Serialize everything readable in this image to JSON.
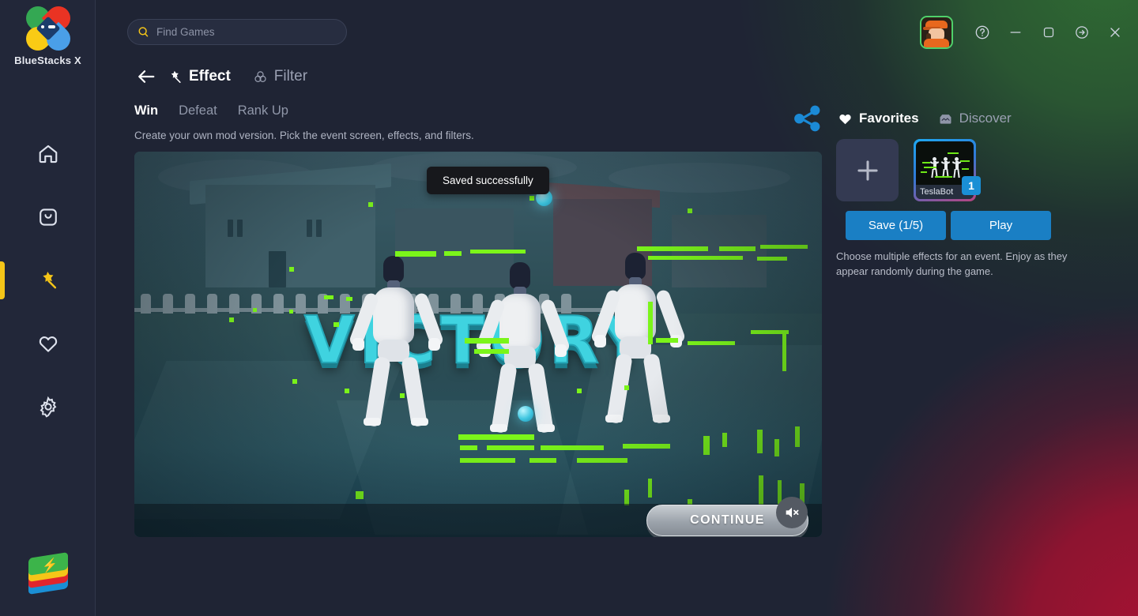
{
  "app": {
    "brand_name": "BlueStacks X",
    "logo_icon": "bluestacks-logo-icon",
    "taskbar_icon": "bluestacks-stack-icon"
  },
  "search": {
    "placeholder": "Find Games",
    "value": "",
    "icon": "search-icon"
  },
  "window_controls": [
    {
      "name": "help-button",
      "icon": "question-circle-icon"
    },
    {
      "name": "minimize-button",
      "icon": "minimize-icon"
    },
    {
      "name": "maximize-button",
      "icon": "maximize-square-icon"
    },
    {
      "name": "exit-button",
      "icon": "arrow-right-circle-icon"
    },
    {
      "name": "close-button",
      "icon": "close-x-icon"
    }
  ],
  "avatar": {
    "name": "user-avatar",
    "icon": "avatar-icon",
    "border_color": "#4fd06a"
  },
  "sidebar": {
    "items": [
      {
        "label": "Home",
        "icon": "home-icon",
        "active": false
      },
      {
        "label": "Store",
        "icon": "bag-icon",
        "active": false
      },
      {
        "label": "Effects",
        "icon": "magic-wand-icon",
        "active": true
      },
      {
        "label": "Favorites",
        "icon": "heart-icon",
        "active": false
      },
      {
        "label": "Settings",
        "icon": "gear-icon",
        "active": false
      }
    ],
    "active_indicator_color": "#f5c518"
  },
  "header": {
    "back_icon": "back-arrow-icon",
    "modes": [
      {
        "label": "Effect",
        "icon": "magic-wand-icon",
        "active": true
      },
      {
        "label": "Filter",
        "icon": "venn-circles-icon",
        "active": false
      }
    ]
  },
  "tabs": [
    {
      "label": "Win",
      "active": true
    },
    {
      "label": "Defeat",
      "active": false
    },
    {
      "label": "Rank Up",
      "active": false
    }
  ],
  "subtitle": "Create your own mod version. Pick the event screen, effects, and filters.",
  "preview": {
    "victory_text": "VICTORY",
    "continue_label": "CONTINUE",
    "mute_icon": "speaker-mute-icon",
    "toast": "Saved successfully"
  },
  "right_panel": {
    "share_icon": "share-icon",
    "segments": [
      {
        "label": "Favorites",
        "icon": "heart-filled-icon",
        "active": true
      },
      {
        "label": "Discover",
        "icon": "store-icon",
        "active": false
      }
    ],
    "add_card": {
      "label": "+",
      "icon": "plus-icon"
    },
    "effect_card": {
      "label": "TeslaBot",
      "badge": "1"
    },
    "buttons": [
      {
        "label": "Save (1/5)",
        "name": "save-button"
      },
      {
        "label": "Play",
        "name": "play-button"
      }
    ],
    "hint": "Choose multiple effects for an event. Enjoy as they appear randomly during the game."
  },
  "colors": {
    "accent_blue": "#1a7fc4",
    "accent_yellow": "#f5c518",
    "background": "#1f2434",
    "sidebar": "#222739",
    "glow_green": "#2f6b33",
    "glow_red": "#a51232"
  }
}
